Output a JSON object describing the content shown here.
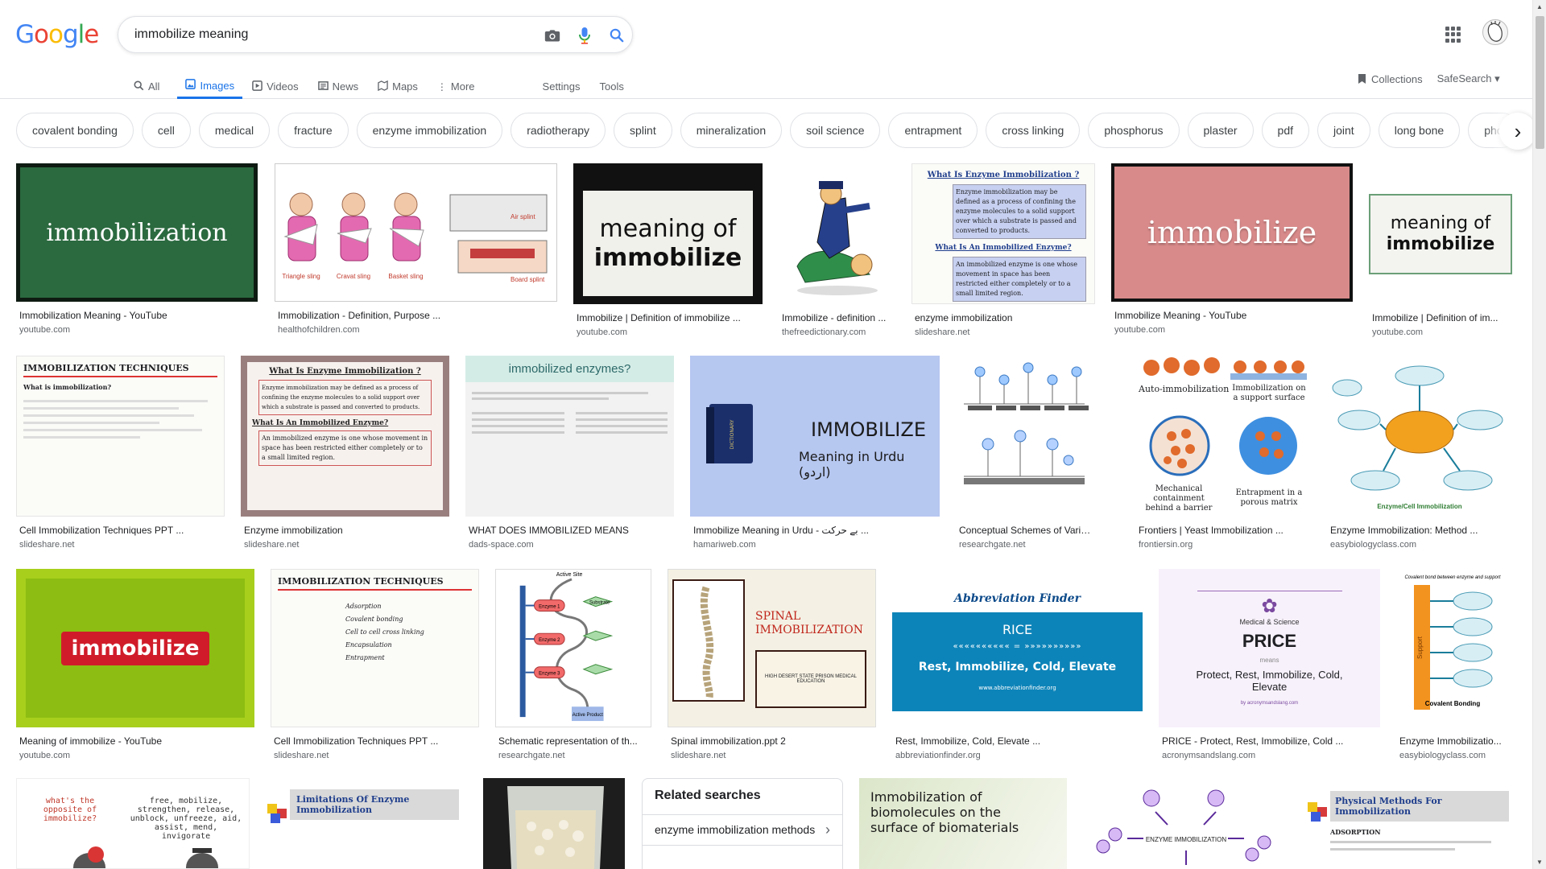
{
  "logo_letters": [
    "G",
    "o",
    "o",
    "g",
    "l",
    "e"
  ],
  "search": {
    "value": "immobilize meaning"
  },
  "icons": {
    "camera": "camera-icon",
    "mic": "mic-icon",
    "search": "search-icon",
    "apps": "apps-grid-icon"
  },
  "colors": {
    "accent": "#1a73e8",
    "brand_blue": "#4285f4",
    "brand_red": "#ea4335",
    "brand_yellow": "#fbbc05",
    "brand_green": "#34a853"
  },
  "tabs": [
    {
      "label": "All",
      "icon": "🔍"
    },
    {
      "label": "Images",
      "icon": "🖼"
    },
    {
      "label": "Videos",
      "icon": "▶"
    },
    {
      "label": "News",
      "icon": "▤"
    },
    {
      "label": "Maps",
      "icon": "⌖"
    },
    {
      "label": "More",
      "icon": "⋮"
    }
  ],
  "tools": {
    "settings": "Settings",
    "tools": "Tools"
  },
  "right_tools": {
    "collections": "Collections",
    "safesearch": "SafeSearch ▾"
  },
  "chips": [
    "covalent bonding",
    "cell",
    "medical",
    "fracture",
    "enzyme immobilization",
    "radiotherapy",
    "splint",
    "mineralization",
    "soil science",
    "entrapment",
    "cross linking",
    "phosphorus",
    "plaster",
    "pdf",
    "joint",
    "long bone",
    "pho"
  ],
  "results": [
    {
      "caption": "Immobilization Meaning - YouTube",
      "source": "youtube.com",
      "thumb_text": "immobilization"
    },
    {
      "caption": "Immobilization - Definition, Purpose ...",
      "source": "healthofchildren.com",
      "thumb_text": "Air splint"
    },
    {
      "caption": "Immobilize | Definition of immobilize ...",
      "source": "youtube.com",
      "thumb_text": "meaning of immobilize"
    },
    {
      "caption": "Immobilize - definition ...",
      "source": "thefreedictionary.com",
      "thumb_text": ""
    },
    {
      "caption": "enzyme immobilization",
      "source": "slideshare.net",
      "thumb_text": "What Is Enzyme Immobilization ?"
    },
    {
      "caption": "Immobilize Meaning - YouTube",
      "source": "youtube.com",
      "thumb_text": "immobilize"
    },
    {
      "caption": "Immobilize | Definition of im...",
      "source": "youtube.com",
      "thumb_text": "meaning of immobilize"
    },
    {
      "caption": "Cell Immobilization Techniques PPT ...",
      "source": "slideshare.net",
      "thumb_text": "IMMOBILIZATION TECHNIQUES"
    },
    {
      "caption": "Enzyme immobilization",
      "source": "slideshare.net",
      "thumb_text": "What Is Enzyme Immobilization ?"
    },
    {
      "caption": "WHAT DOES IMMOBILIZED MEANS",
      "source": "dads-space.com",
      "thumb_text": "immobilized enzymes?"
    },
    {
      "caption": "Immobilize Meaning in Urdu - بے حرکت ...",
      "source": "hamariweb.com",
      "thumb_text": "IMMOBILIZE"
    },
    {
      "caption": "Conceptual Schemes of Various ...",
      "source": "researchgate.net",
      "thumb_text": ""
    },
    {
      "caption": "Frontiers | Yeast Immobilization ...",
      "source": "frontiersin.org",
      "thumb_text": "Auto-immobilization"
    },
    {
      "caption": "Enzyme Immobilization: Method ...",
      "source": "easybiologyclass.com",
      "thumb_text": "Enzyme/Cell Immobilization"
    },
    {
      "caption": "Meaning of immobilize - YouTube",
      "source": "youtube.com",
      "thumb_text": "immobilize"
    },
    {
      "caption": "Cell Immobilization Techniques PPT ...",
      "source": "slideshare.net",
      "thumb_text": "IMMOBILIZATION TECHNIQUES"
    },
    {
      "caption": "Schematic representation of th...",
      "source": "researchgate.net",
      "thumb_text": "Active Site"
    },
    {
      "caption": "Spinal immobilization.ppt 2",
      "source": "slideshare.net",
      "thumb_text": "SPINAL IMMOBILIZATION"
    },
    {
      "caption": "Rest, Immobilize, Cold, Elevate ...",
      "source": "abbreviationfinder.org",
      "thumb_text": "RICE"
    },
    {
      "caption": "PRICE - Protect, Rest, Immobilize, Cold ...",
      "source": "acronymsandslang.com",
      "thumb_text": "PRICE"
    },
    {
      "caption": "Enzyme Immobilizatio...",
      "source": "easybiologyclass.com",
      "thumb_text": "Covalent Bonding"
    }
  ],
  "thumb_texts": {
    "book_line1": "meaning of",
    "book_line2": "immobilize",
    "sling_labels": [
      "Triangle sling",
      "Cravat sling",
      "Basket sling",
      "Board splint"
    ],
    "enzyme_def": "Enzyme immobilization may be defined as a process of confining the enzyme molecules to a solid support over which a substrate is passed and converted to products.",
    "immobilized_q": "What Is An Immobilized Enzyme?",
    "immobilized_def": "An immobilized enzyme is one whose movement in space has been restricted either completely or to a small limited region.",
    "techniques_q": "What is immobilization?",
    "urdu_sub": "Meaning in Urdu (اردو)",
    "dictionary": "DICTIONARY",
    "frontiers": [
      "Immobilization on a support surface",
      "Mechanical containment behind a barrier",
      "Entrapment in a porous matrix"
    ],
    "abbr_brand": "Abbreviation Finder",
    "rice_full": "Rest, Immobilize, Cold, Elevate",
    "rice_url": "www.abbreviationfinder.org",
    "price_top": "Medical & Science",
    "price_means": "means",
    "price_full": "Protect, Rest, Immobilize, Cold, Elevate",
    "price_by": "by acronymsandslang.com",
    "spinal_sub": "HIGH DESERT STATE PRISON MEDICAL EDUCATION",
    "active_site": "Active Site",
    "active_product": "Active Product",
    "enzymes": [
      "Enzyme 1",
      "Enzyme 2",
      "Enzyme 3"
    ],
    "substrate": "Substrate",
    "covalent_top": "Covalent bond between enzyme and support",
    "support": "Support",
    "cell_list": [
      "Adsorption",
      "Covalent bonding",
      "Cell to cell cross linking",
      "Encapsulation",
      "Entrapment"
    ],
    "opposite_q": "what's the opposite of immobilize?",
    "opposite_list": "free, mobilize, strengthen, release, unblock, unfreeze, aid, assist, mend, invigorate",
    "limitations": "Limitations Of Enzyme Immobilization",
    "bio_title": "Immobilization of biomolecules on the surface of biomaterials",
    "enzyme_immob": "ENZYME IMMOBILIZATION",
    "physical": "Physical Methods For Immobilization",
    "adsorption": "ADSORPTION"
  },
  "related": {
    "title": "Related searches",
    "items": [
      "enzyme immobilization methods"
    ]
  }
}
